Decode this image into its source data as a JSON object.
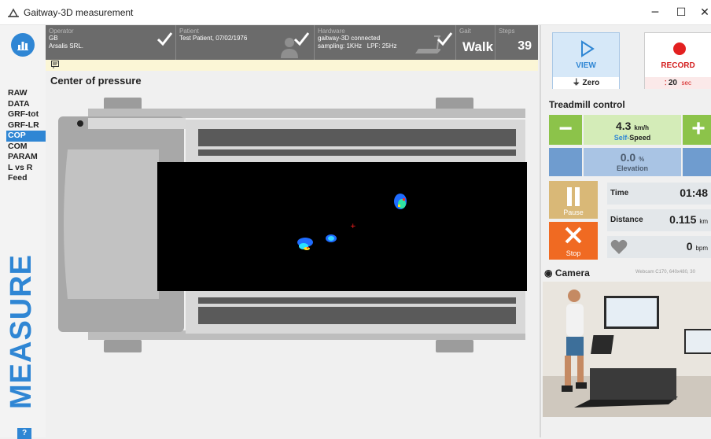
{
  "window": {
    "title": "Gaitway-3D measurement",
    "minimize": "─",
    "maximize": "☐",
    "close": "✕"
  },
  "nav": {
    "items": [
      "RAW",
      "DATA",
      "GRF-tot",
      "GRF-LR",
      "COP",
      "COM",
      "PARAM",
      "L vs R",
      "Feed"
    ],
    "active": "COP",
    "mode_label": "MEASURE",
    "help": "?"
  },
  "header": {
    "operator_label": "Operator",
    "operator_value": "GB\nArsalis SRL.",
    "patient_label": "Patient",
    "patient_value": "Test Patient, 07/02/1976",
    "hardware_label": "Hardware",
    "hardware_value": "gaitway-3D connected\nsampling: 1KHz   LPF: 25Hz",
    "gait_label": "Gait",
    "gait_value": "Walk",
    "steps_label": "Steps",
    "steps_value": "39"
  },
  "main": {
    "title": "Center of pressure"
  },
  "record": {
    "view_label": "VIEW",
    "zero_label": "Zero",
    "record_label": "RECORD",
    "record_time": "20",
    "record_unit": "sec"
  },
  "treadmill": {
    "title": "Treadmill control",
    "speed_value": "4.3",
    "speed_unit": "km/h",
    "speed_self": "Self-",
    "speed_label": "Speed",
    "elevation_value": "0.0",
    "elevation_unit": "%",
    "elevation_label": "Elevation",
    "pause_label": "Pause",
    "stop_label": "Stop",
    "time_label": "Time",
    "time_value": "01:48",
    "distance_label": "Distance",
    "distance_value": "0.115",
    "distance_unit": "km",
    "hr_value": "0",
    "hr_unit": "bpm"
  },
  "camera": {
    "title": "Camera",
    "info": "Webcam C170, 640x480, 30"
  },
  "colors": {
    "accent": "#2f86d4",
    "green": "#8cc34a",
    "record_red": "#d42020",
    "stop_orange": "#f06a22",
    "pause_tan": "#d9b877"
  }
}
